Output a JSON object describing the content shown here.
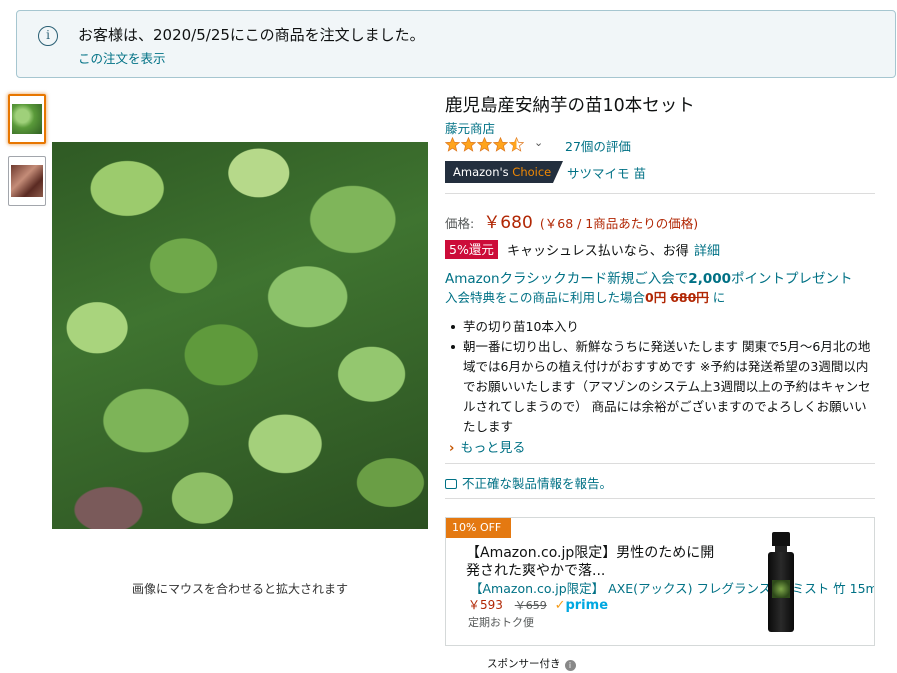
{
  "notice": {
    "message": "お客様は、2020/5/25にこの商品を注文しました。",
    "link": "この注文を表示",
    "icon": "info-icon"
  },
  "gallery": {
    "thumbnails": [
      "sweet-potato-leaves-thumbnail",
      "sweet-potato-cuttings-thumbnail"
    ],
    "zoom_hint": "画像にマウスを合わせると拡大されます"
  },
  "product": {
    "title": "鹿児島産安納芋の苗10本セット",
    "brand": "藤元商店",
    "rating": {
      "stars": 4.5,
      "count_text": "27個の評価"
    },
    "badge": {
      "prefix": "Amazon's ",
      "highlight": "Choice"
    },
    "badge_keyword": "サツマイモ 苗"
  },
  "pricing": {
    "label": "価格:",
    "price": "￥680",
    "unit_price": "(￥68 / 1商品あたりの価格)",
    "cashback_badge": "5%還元",
    "cashback_text": "キャッシュレス払いなら、お得",
    "cashback_link": "詳細",
    "card_offer": {
      "line1_pre": "Amazonクラシックカード新規ご入会で",
      "line1_strong": "2,000",
      "line1_post": "ポイントプレゼント",
      "line2_pre": "入会特典をこの商品に利用した場合",
      "line2_zero": "0円",
      "line2_strike": "680円",
      "line2_post": " に"
    }
  },
  "features": [
    "芋の切り苗10本入り",
    "朝一番に切り出し、新鮮なうちに発送いたします 関東で5月～6月北の地域では6月からの植え付けがおすすめです ※予約は発送希望の3週間以内でお願いいたします（アマゾンのシステム上3週間以上の予約はキャンセルされてしまうので） 商品には余裕がございますのでよろしくお願いいたします"
  ],
  "see_more": "もっと見る",
  "report_link": "不正確な製品情報を報告。",
  "ad": {
    "discount_badge": "10% OFF",
    "headline": "【Amazon.co.jp限定】男性のために開発された爽やかで落...",
    "subtitle": "【Amazon.co.jp限定】 AXE(アックス) フレグランス ボ  ミスト 竹 15m",
    "price": "￥593",
    "list_price": "￥659",
    "prime": "prime",
    "subscribe": "定期おトク便"
  },
  "sponsored": "スポンサー付き",
  "colors": {
    "link": "#007185",
    "price": "#b12704",
    "accent_orange": "#e47911",
    "badge_dark": "#232f3e",
    "cashback_red": "#cc0c39"
  }
}
